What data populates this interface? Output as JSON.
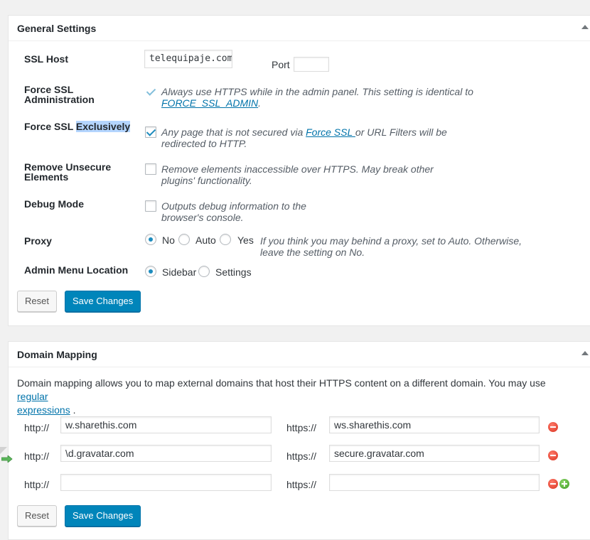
{
  "general": {
    "title": "General Settings",
    "ssl_host": {
      "label": "SSL Host",
      "value": "telequipaje.com",
      "port_label": "Port",
      "port_value": ""
    },
    "force_ssl_admin": {
      "label_line1": "Force SSL",
      "label_line2": "Administration",
      "desc_line1": "Always use HTTPS while in the admin panel. This setting is identical to",
      "desc_link": "FORCE_SSL_ADMIN",
      "desc_end": "."
    },
    "force_ssl_exclusive": {
      "label_pre": "Force SSL ",
      "label_highlight": "Exclusively",
      "desc_pre": "Any page that is not secured via ",
      "desc_link": "Force SSL ",
      "desc_post": "or URL Filters will be",
      "desc_line2": "redirected to HTTP."
    },
    "remove_unsecure": {
      "label_line1": "Remove Unsecure",
      "label_line2": "Elements",
      "desc_line1": "Remove elements inaccessible over HTTPS. May break other",
      "desc_line2": "plugins' functionality."
    },
    "debug_mode": {
      "label": "Debug Mode",
      "desc_line1": "Outputs debug information to the",
      "desc_line2": "browser's console."
    },
    "proxy": {
      "label": "Proxy",
      "options": [
        "No",
        "Auto",
        "Yes"
      ],
      "selected": "No",
      "desc_line1": "If you think you may behind a proxy, set to Auto. Otherwise,",
      "desc_line2": "leave the setting on No."
    },
    "admin_menu": {
      "label": "Admin Menu Location",
      "options": [
        "Sidebar",
        "Settings"
      ],
      "selected": "Sidebar"
    },
    "reset_label": "Reset",
    "save_label": "Save Changes"
  },
  "domain_mapping": {
    "title": "Domain Mapping",
    "intro_pre": "Domain mapping allows you to map external domains that host their HTTPS content on a different domain. You may use ",
    "intro_link1": "regular",
    "intro_link2": "expressions",
    "intro_post": " .",
    "http_label": "http://",
    "https_label": "https://",
    "rows": [
      {
        "from": "w.sharethis.com",
        "to": "ws.sharethis.com"
      },
      {
        "from": "\\d.gravatar.com",
        "to": "secure.gravatar.com"
      },
      {
        "from": "",
        "to": ""
      }
    ],
    "reset_label": "Reset",
    "save_label": "Save Changes"
  },
  "colors": {
    "primary": "#0085ba",
    "link": "#0073aa",
    "check": "#1e8cbe",
    "remove": "#d9321f",
    "add": "#3c9a23"
  }
}
